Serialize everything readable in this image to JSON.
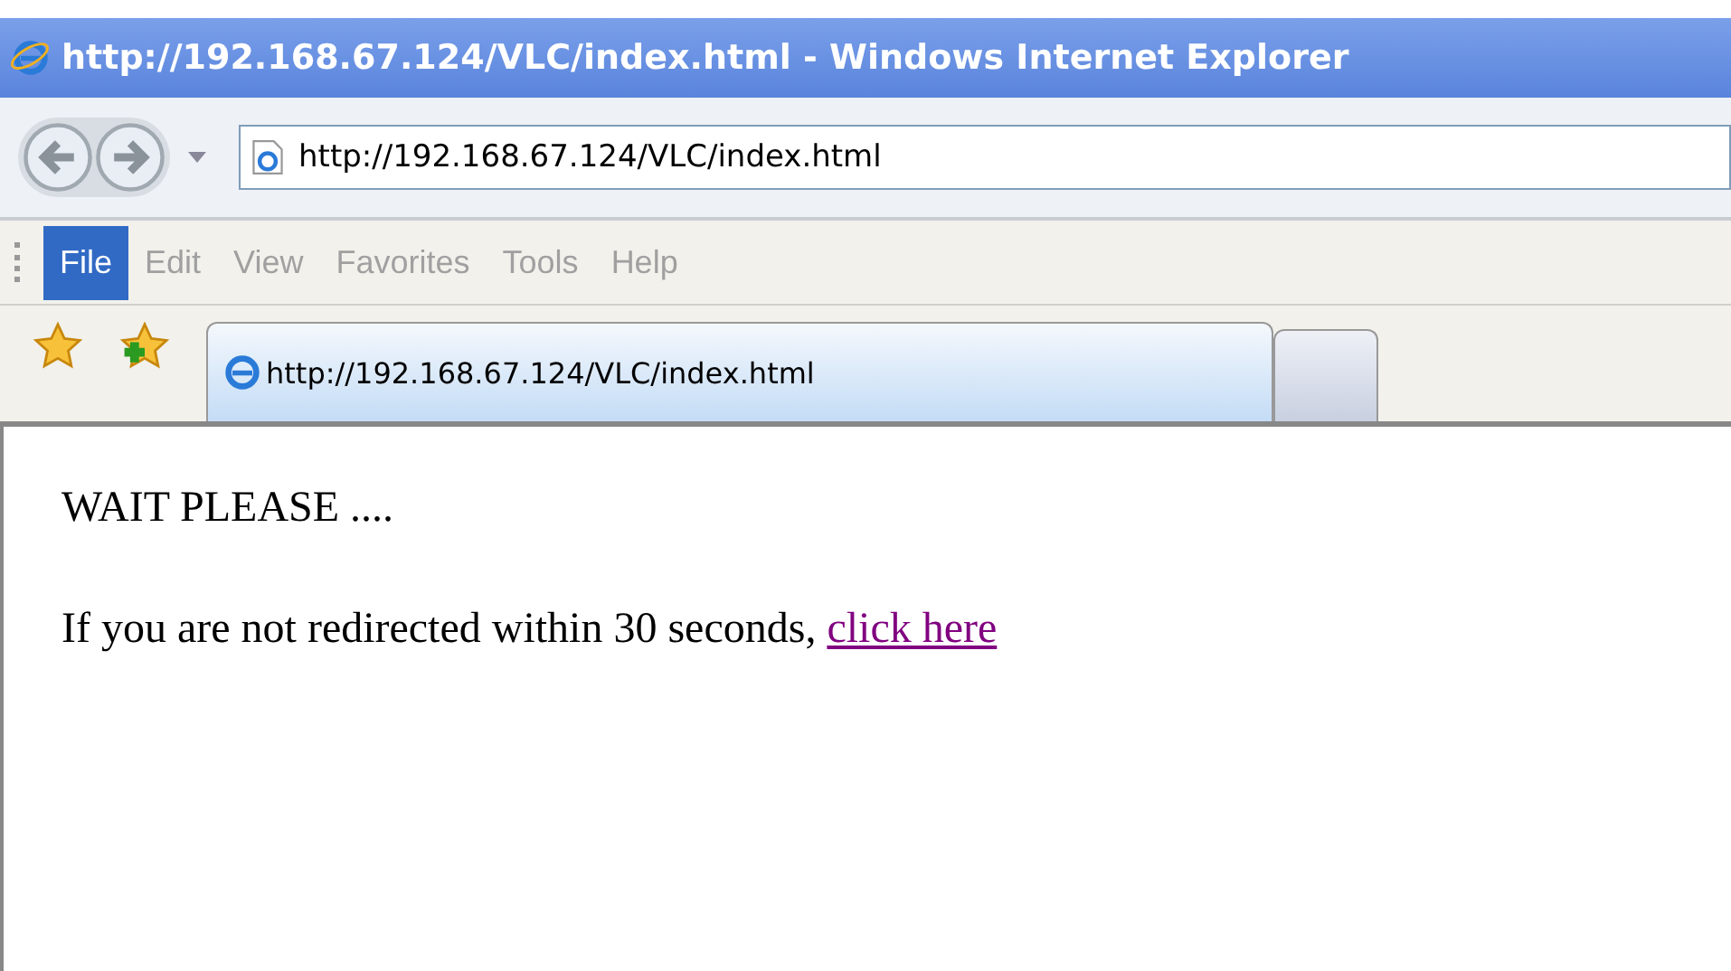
{
  "window": {
    "title": "http://192.168.67.124/VLC/index.html - Windows Internet Explorer"
  },
  "address_bar": {
    "value": "http://192.168.67.124/VLC/index.html"
  },
  "menu": [
    {
      "label": "File",
      "selected": true
    },
    {
      "label": "Edit",
      "selected": false
    },
    {
      "label": "View",
      "selected": false
    },
    {
      "label": "Favorites",
      "selected": false
    },
    {
      "label": "Tools",
      "selected": false
    },
    {
      "label": "Help",
      "selected": false
    }
  ],
  "tabs": [
    {
      "label": "http://192.168.67.124/VLC/index.html",
      "selected": true
    }
  ],
  "page": {
    "heading": "WAIT PLEASE ....",
    "message": "If you are not redirected within 30 seconds,",
    "link": "click here"
  }
}
